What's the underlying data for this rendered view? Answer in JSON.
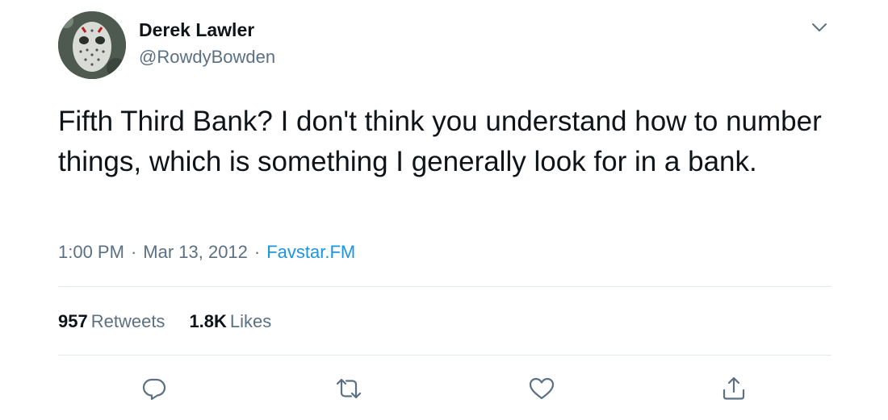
{
  "author": {
    "display_name": "Derek Lawler",
    "handle": "@RowdyBowden",
    "avatar_icon": "hockey-mask-avatar"
  },
  "tweet": {
    "text": "Fifth Third Bank? I don't think you understand how to number things, which is something I generally look for in a bank."
  },
  "meta": {
    "time": "1:00 PM",
    "separator": "·",
    "date": "Mar 13, 2012",
    "source": "Favstar.FM"
  },
  "stats": {
    "retweets_count": "957",
    "retweets_label": "Retweets",
    "likes_count": "1.8K",
    "likes_label": "Likes"
  },
  "actions": {
    "reply_icon": "reply-icon",
    "retweet_icon": "retweet-icon",
    "like_icon": "heart-icon",
    "share_icon": "share-icon"
  },
  "colors": {
    "primary_text": "#0f1419",
    "secondary_text": "#5b7083",
    "link": "#1b95e0",
    "divider": "#e1e8ed"
  }
}
